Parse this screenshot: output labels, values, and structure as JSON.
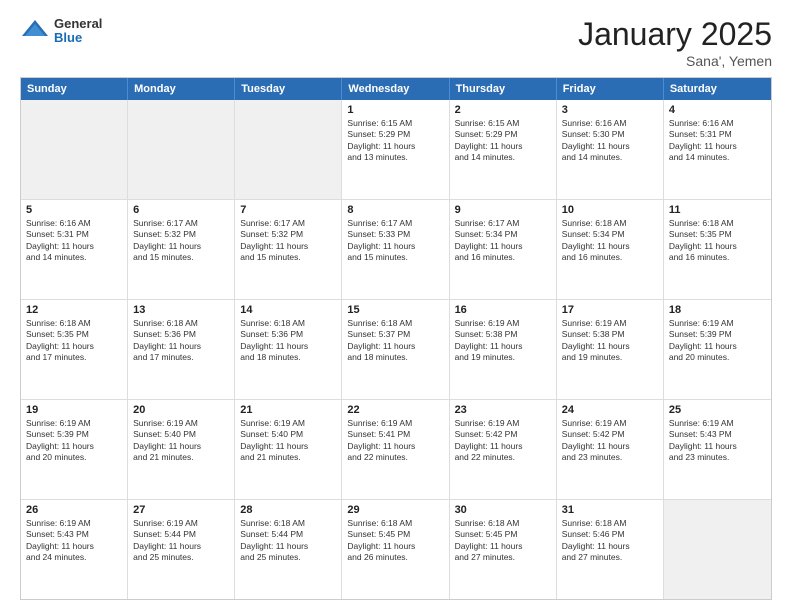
{
  "header": {
    "logo_general": "General",
    "logo_blue": "Blue",
    "title": "January 2025",
    "location": "Sana', Yemen"
  },
  "days_of_week": [
    "Sunday",
    "Monday",
    "Tuesday",
    "Wednesday",
    "Thursday",
    "Friday",
    "Saturday"
  ],
  "weeks": [
    [
      {
        "day": "",
        "text": "",
        "shaded": true
      },
      {
        "day": "",
        "text": "",
        "shaded": true
      },
      {
        "day": "",
        "text": "",
        "shaded": true
      },
      {
        "day": "1",
        "text": "Sunrise: 6:15 AM\nSunset: 5:29 PM\nDaylight: 11 hours\nand 13 minutes."
      },
      {
        "day": "2",
        "text": "Sunrise: 6:15 AM\nSunset: 5:29 PM\nDaylight: 11 hours\nand 14 minutes."
      },
      {
        "day": "3",
        "text": "Sunrise: 6:16 AM\nSunset: 5:30 PM\nDaylight: 11 hours\nand 14 minutes."
      },
      {
        "day": "4",
        "text": "Sunrise: 6:16 AM\nSunset: 5:31 PM\nDaylight: 11 hours\nand 14 minutes."
      }
    ],
    [
      {
        "day": "5",
        "text": "Sunrise: 6:16 AM\nSunset: 5:31 PM\nDaylight: 11 hours\nand 14 minutes."
      },
      {
        "day": "6",
        "text": "Sunrise: 6:17 AM\nSunset: 5:32 PM\nDaylight: 11 hours\nand 15 minutes."
      },
      {
        "day": "7",
        "text": "Sunrise: 6:17 AM\nSunset: 5:32 PM\nDaylight: 11 hours\nand 15 minutes."
      },
      {
        "day": "8",
        "text": "Sunrise: 6:17 AM\nSunset: 5:33 PM\nDaylight: 11 hours\nand 15 minutes."
      },
      {
        "day": "9",
        "text": "Sunrise: 6:17 AM\nSunset: 5:34 PM\nDaylight: 11 hours\nand 16 minutes."
      },
      {
        "day": "10",
        "text": "Sunrise: 6:18 AM\nSunset: 5:34 PM\nDaylight: 11 hours\nand 16 minutes."
      },
      {
        "day": "11",
        "text": "Sunrise: 6:18 AM\nSunset: 5:35 PM\nDaylight: 11 hours\nand 16 minutes."
      }
    ],
    [
      {
        "day": "12",
        "text": "Sunrise: 6:18 AM\nSunset: 5:35 PM\nDaylight: 11 hours\nand 17 minutes."
      },
      {
        "day": "13",
        "text": "Sunrise: 6:18 AM\nSunset: 5:36 PM\nDaylight: 11 hours\nand 17 minutes."
      },
      {
        "day": "14",
        "text": "Sunrise: 6:18 AM\nSunset: 5:36 PM\nDaylight: 11 hours\nand 18 minutes."
      },
      {
        "day": "15",
        "text": "Sunrise: 6:18 AM\nSunset: 5:37 PM\nDaylight: 11 hours\nand 18 minutes."
      },
      {
        "day": "16",
        "text": "Sunrise: 6:19 AM\nSunset: 5:38 PM\nDaylight: 11 hours\nand 19 minutes."
      },
      {
        "day": "17",
        "text": "Sunrise: 6:19 AM\nSunset: 5:38 PM\nDaylight: 11 hours\nand 19 minutes."
      },
      {
        "day": "18",
        "text": "Sunrise: 6:19 AM\nSunset: 5:39 PM\nDaylight: 11 hours\nand 20 minutes."
      }
    ],
    [
      {
        "day": "19",
        "text": "Sunrise: 6:19 AM\nSunset: 5:39 PM\nDaylight: 11 hours\nand 20 minutes."
      },
      {
        "day": "20",
        "text": "Sunrise: 6:19 AM\nSunset: 5:40 PM\nDaylight: 11 hours\nand 21 minutes."
      },
      {
        "day": "21",
        "text": "Sunrise: 6:19 AM\nSunset: 5:40 PM\nDaylight: 11 hours\nand 21 minutes."
      },
      {
        "day": "22",
        "text": "Sunrise: 6:19 AM\nSunset: 5:41 PM\nDaylight: 11 hours\nand 22 minutes."
      },
      {
        "day": "23",
        "text": "Sunrise: 6:19 AM\nSunset: 5:42 PM\nDaylight: 11 hours\nand 22 minutes."
      },
      {
        "day": "24",
        "text": "Sunrise: 6:19 AM\nSunset: 5:42 PM\nDaylight: 11 hours\nand 23 minutes."
      },
      {
        "day": "25",
        "text": "Sunrise: 6:19 AM\nSunset: 5:43 PM\nDaylight: 11 hours\nand 23 minutes."
      }
    ],
    [
      {
        "day": "26",
        "text": "Sunrise: 6:19 AM\nSunset: 5:43 PM\nDaylight: 11 hours\nand 24 minutes."
      },
      {
        "day": "27",
        "text": "Sunrise: 6:19 AM\nSunset: 5:44 PM\nDaylight: 11 hours\nand 25 minutes."
      },
      {
        "day": "28",
        "text": "Sunrise: 6:18 AM\nSunset: 5:44 PM\nDaylight: 11 hours\nand 25 minutes."
      },
      {
        "day": "29",
        "text": "Sunrise: 6:18 AM\nSunset: 5:45 PM\nDaylight: 11 hours\nand 26 minutes."
      },
      {
        "day": "30",
        "text": "Sunrise: 6:18 AM\nSunset: 5:45 PM\nDaylight: 11 hours\nand 27 minutes."
      },
      {
        "day": "31",
        "text": "Sunrise: 6:18 AM\nSunset: 5:46 PM\nDaylight: 11 hours\nand 27 minutes."
      },
      {
        "day": "",
        "text": "",
        "shaded": true
      }
    ]
  ]
}
